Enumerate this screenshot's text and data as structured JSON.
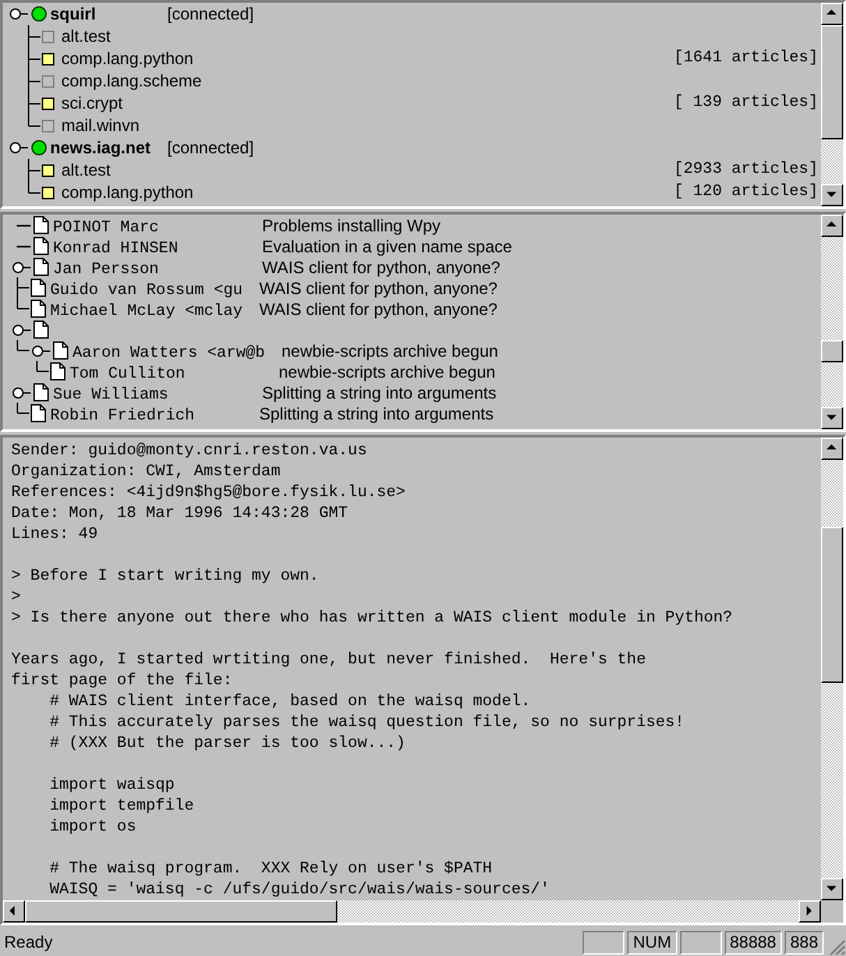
{
  "servers": [
    {
      "name": "squirl",
      "status": "[connected]",
      "connected": true,
      "groups": [
        {
          "name": "alt.test",
          "subscribed": false
        },
        {
          "name": "comp.lang.python",
          "subscribed": true,
          "articles": "[1641 articles]"
        },
        {
          "name": "comp.lang.scheme",
          "subscribed": false
        },
        {
          "name": "sci.crypt",
          "subscribed": true,
          "articles": "[ 139 articles]"
        },
        {
          "name": "mail.winvn",
          "subscribed": false
        }
      ]
    },
    {
      "name": "news.iag.net",
      "status": "[connected]",
      "connected": true,
      "groups": [
        {
          "name": "alt.test",
          "subscribed": true,
          "articles": "[2933 articles]"
        },
        {
          "name": "comp.lang.python",
          "subscribed": true,
          "articles": "[ 120 articles]"
        }
      ]
    }
  ],
  "threads": [
    {
      "author": "POINOT Marc",
      "subject": "Problems installing Wpy"
    },
    {
      "author": "Konrad HINSEN",
      "subject": "Evaluation in a given name space"
    },
    {
      "author": "Jan Persson",
      "subject": "WAIS client for python, anyone?",
      "children": [
        {
          "author": "Guido van Rossum <gu",
          "subject": "WAIS client for python, anyone?"
        },
        {
          "author": "Michael McLay <mclay",
          "subject": "WAIS client for python, anyone?"
        }
      ]
    },
    {
      "children": [
        {
          "author": "Aaron Watters <arw@b",
          "subject": "newbie-scripts archive begun",
          "children": [
            {
              "author": "Tom Culliton",
              "subject": "newbie-scripts archive begun"
            }
          ]
        }
      ]
    },
    {
      "author": "Sue Williams",
      "subject": "Splitting a string into arguments",
      "children": [
        {
          "author": "Robin Friedrich",
          "subject": "Splitting a string into arguments"
        }
      ]
    }
  ],
  "message": [
    [
      "Sender: guido@monty.cnri.reston.va.us",
      "Organization: CWI, Amsterdam",
      "References: <4ijd9n$hg5@bore.fysik.lu.se>",
      "Date: Mon, 18 Mar 1996 14:43:28 GMT",
      "Lines: 49"
    ],
    [
      "> Before I start writing my own.",
      ">",
      "> Is there anyone out there who has written a WAIS client module in Python?"
    ],
    [
      "Years ago, I started wrtiting one, but never finished.  Here's the",
      "first page of the file:",
      "    # WAIS client interface, based on the waisq model.",
      "    # This accurately parses the waisq question file, so no surprises!",
      "    # (XXX But the parser is too slow...)"
    ],
    [
      "    import waisqp",
      "    import tempfile",
      "    import os"
    ],
    [
      "    # The waisq program.  XXX Rely on user's $PATH",
      "    WAISQ = 'waisq -c /ufs/guido/src/wais/wais-sources/'"
    ]
  ],
  "status_bar": {
    "message": "Ready",
    "panels": [
      {
        "kind": "blank"
      },
      {
        "kind": "text",
        "text": "NUM"
      },
      {
        "kind": "blank"
      },
      {
        "kind": "text",
        "text": "88888"
      },
      {
        "kind": "text",
        "text": "888"
      }
    ]
  }
}
